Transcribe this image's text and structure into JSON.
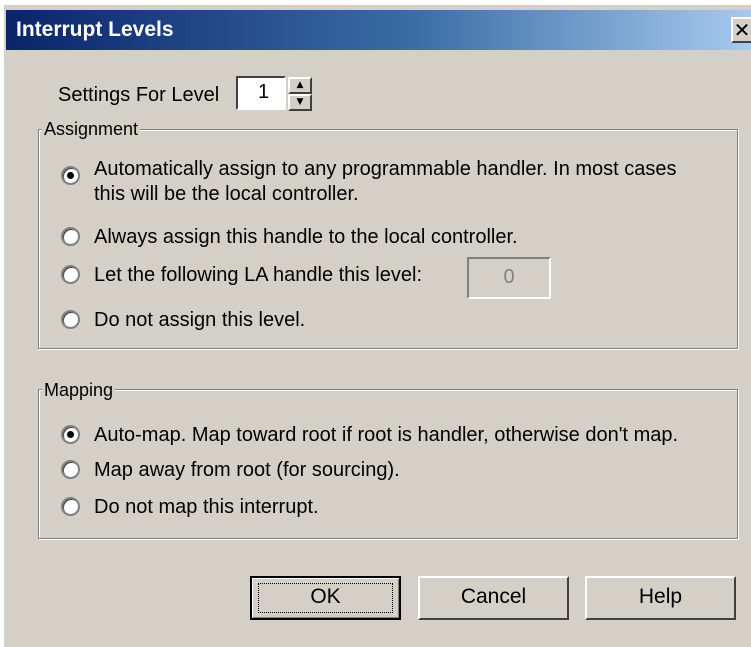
{
  "window": {
    "title": "Interrupt Levels",
    "close_glyph": "✕"
  },
  "level": {
    "label": "Settings For Level",
    "value": "1"
  },
  "assignment": {
    "group_label": "Assignment",
    "options": [
      {
        "line1": "Automatically assign to any programmable handler.  In most cases",
        "line2": "this will be the local controller.",
        "checked": true
      },
      {
        "line1": "Always assign this handle to the local controller.",
        "checked": false
      },
      {
        "line1": "Let the following LA handle this level:",
        "checked": false
      },
      {
        "line1": "Do not assign this level.",
        "checked": false
      }
    ],
    "la_value": "0"
  },
  "mapping": {
    "group_label": "Mapping",
    "options": [
      {
        "label": "Auto-map.  Map toward root if root is handler, otherwise don't map.",
        "checked": true
      },
      {
        "label": "Map away from root (for sourcing).",
        "checked": false
      },
      {
        "label": "Do not map this interrupt.",
        "checked": false
      }
    ]
  },
  "buttons": {
    "ok": "OK",
    "cancel": "Cancel",
    "help": "Help"
  }
}
